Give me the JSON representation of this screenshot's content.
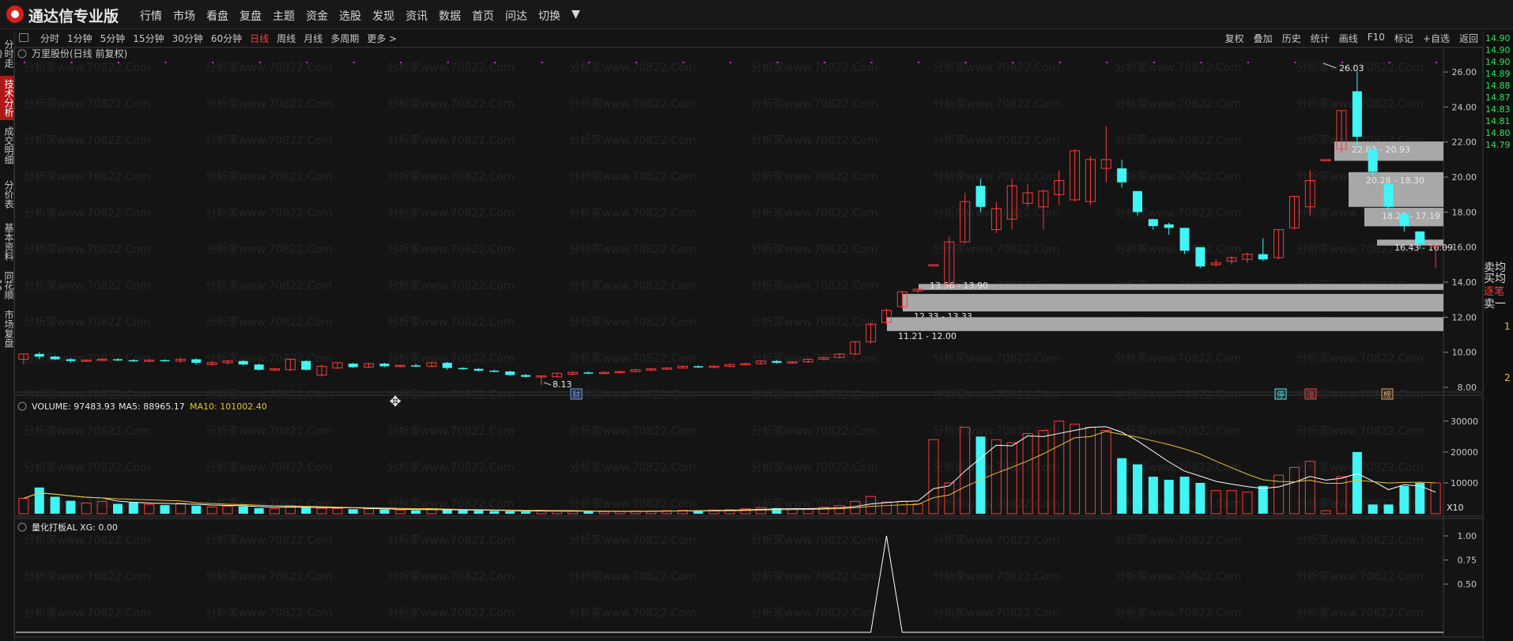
{
  "app": {
    "title": "通达信专业版"
  },
  "menu": [
    "行情",
    "市场",
    "看盘",
    "复盘",
    "主题",
    "资金",
    "选股",
    "发现",
    "资讯",
    "数据",
    "首页",
    "问达",
    "切换",
    "▼"
  ],
  "periods": [
    {
      "label": "分时",
      "active": false
    },
    {
      "label": "1分钟",
      "active": false
    },
    {
      "label": "5分钟",
      "active": false
    },
    {
      "label": "15分钟",
      "active": false
    },
    {
      "label": "30分钟",
      "active": false
    },
    {
      "label": "60分钟",
      "active": false
    },
    {
      "label": "日线",
      "active": true
    },
    {
      "label": "周线",
      "active": false
    },
    {
      "label": "月线",
      "active": false
    },
    {
      "label": "多周期",
      "active": false
    },
    {
      "label": "更多 >",
      "active": false
    }
  ],
  "right_tools": [
    "复权",
    "叠加",
    "历史",
    "统计",
    "画线",
    "F10",
    "标记",
    "+自选",
    "返回"
  ],
  "left_nav": [
    {
      "label": "分时走势",
      "active": false
    },
    {
      "label": "技术分析",
      "active": true
    },
    {
      "label": "成交明细",
      "active": false
    },
    {
      "label": "分价表",
      "active": false
    },
    {
      "label": "基本资料",
      "active": false
    },
    {
      "label": "同花顺10",
      "active": false
    },
    {
      "label": "市场复盘",
      "active": false
    }
  ],
  "main_title": "万里股份(日线 前复权)",
  "price_axis": [
    "26.00",
    "24.00",
    "22.00",
    "20.00",
    "18.00",
    "16.00",
    "14.00",
    "12.00",
    "10.00",
    "8.00"
  ],
  "right_prices": [
    "14.90",
    "14.90",
    "14.90",
    "14.89",
    "14.88",
    "14.87",
    "14.83",
    "14.81",
    "14.80",
    "14.79"
  ],
  "right_labels": [
    "卖均",
    "买均",
    "逐笔",
    "卖一",
    "1",
    "2"
  ],
  "annotations": {
    "high": "26.03",
    "low": "8.13",
    "cai": "财",
    "ting": "停",
    "zhang": "涨",
    "bang": "榜"
  },
  "price_zones": [
    {
      "label": "22.03 - 20.93",
      "color": "#a8a8a8"
    },
    {
      "label": "20.28 - 18.30",
      "color": "#a8a8a8"
    },
    {
      "label": "18.25 - 17.19",
      "color": "#a8a8a8"
    },
    {
      "label": "16.43 - 16.09",
      "color": "#a8a8a8"
    },
    {
      "label": "13.56 - 13.90",
      "color": "#a8a8a8"
    },
    {
      "label": "12.33 - 13.33",
      "color": "#a8a8a8"
    },
    {
      "label": "11.21 - 12.00",
      "color": "#a8a8a8"
    }
  ],
  "volume": {
    "header_name": "VOLUME: 97483.93",
    "ma5": "MA5: 88965.17",
    "ma10": "MA10: 101002.40",
    "axis": [
      "30000",
      "20000",
      "10000"
    ],
    "unit": "X10"
  },
  "indicator": {
    "header": "量化打板AL  XG: 0.00",
    "axis": [
      "1.00",
      "0.75",
      "0.50"
    ]
  },
  "watermark": "分析家www.70822.Com",
  "colors": {
    "up": "#ff3a3a",
    "down": "#3ff5f5",
    "ma5": "#ffffff",
    "ma10": "#e8c230",
    "accent": "#ff3b3b"
  },
  "chart_data": {
    "type": "candlestick",
    "ylim": [
      8,
      26.5
    ],
    "candles": [
      [
        9.6,
        9.9,
        9.3,
        9.9
      ],
      [
        9.9,
        9.75,
        9.6,
        10.0
      ],
      [
        9.75,
        9.6,
        9.55,
        9.8
      ],
      [
        9.6,
        9.5,
        9.4,
        9.65
      ],
      [
        9.5,
        9.55,
        9.45,
        9.6
      ],
      [
        9.55,
        9.6,
        9.5,
        9.65
      ],
      [
        9.6,
        9.55,
        9.5,
        9.65
      ],
      [
        9.55,
        9.5,
        9.45,
        9.6
      ],
      [
        9.5,
        9.55,
        9.45,
        9.6
      ],
      [
        9.55,
        9.5,
        9.45,
        9.6
      ],
      [
        9.5,
        9.6,
        9.4,
        9.7
      ],
      [
        9.6,
        9.4,
        9.3,
        9.65
      ],
      [
        9.3,
        9.4,
        9.25,
        9.5
      ],
      [
        9.4,
        9.5,
        9.3,
        9.55
      ],
      [
        9.5,
        9.3,
        9.25,
        9.55
      ],
      [
        9.3,
        9.0,
        8.95,
        9.35
      ],
      [
        9.0,
        9.05,
        8.95,
        9.1
      ],
      [
        9.0,
        9.6,
        8.95,
        9.65
      ],
      [
        9.5,
        9.0,
        8.95,
        9.55
      ],
      [
        8.7,
        9.2,
        8.6,
        9.3
      ],
      [
        9.1,
        9.4,
        9.05,
        9.45
      ],
      [
        9.35,
        9.15,
        9.1,
        9.4
      ],
      [
        9.15,
        9.35,
        9.1,
        9.4
      ],
      [
        9.35,
        9.2,
        9.15,
        9.4
      ],
      [
        9.2,
        9.25,
        9.15,
        9.3
      ],
      [
        9.25,
        9.2,
        9.15,
        9.35
      ],
      [
        9.2,
        9.4,
        9.15,
        9.45
      ],
      [
        9.4,
        9.1,
        9.0,
        9.45
      ],
      [
        9.1,
        9.05,
        9.0,
        9.15
      ],
      [
        9.05,
        8.95,
        8.9,
        9.1
      ],
      [
        8.95,
        8.9,
        8.85,
        9.0
      ],
      [
        8.9,
        8.7,
        8.65,
        8.95
      ],
      [
        8.7,
        8.6,
        8.55,
        8.75
      ],
      [
        8.6,
        8.65,
        8.13,
        8.7
      ],
      [
        8.6,
        8.8,
        8.55,
        8.85
      ],
      [
        8.75,
        8.85,
        8.7,
        8.9
      ],
      [
        8.85,
        8.8,
        8.75,
        8.9
      ],
      [
        8.8,
        8.85,
        8.75,
        8.9
      ],
      [
        8.85,
        8.9,
        8.8,
        8.95
      ],
      [
        8.9,
        9.0,
        8.85,
        9.05
      ],
      [
        9.0,
        9.05,
        8.95,
        9.1
      ],
      [
        9.05,
        9.1,
        9.0,
        9.15
      ],
      [
        9.1,
        9.2,
        9.05,
        9.25
      ],
      [
        9.2,
        9.15,
        9.1,
        9.25
      ],
      [
        9.15,
        9.2,
        9.1,
        9.25
      ],
      [
        9.2,
        9.3,
        9.15,
        9.35
      ],
      [
        9.3,
        9.35,
        9.25,
        9.4
      ],
      [
        9.35,
        9.5,
        9.3,
        9.55
      ],
      [
        9.5,
        9.4,
        9.35,
        9.55
      ],
      [
        9.4,
        9.45,
        9.35,
        9.5
      ],
      [
        9.45,
        9.6,
        9.4,
        9.65
      ],
      [
        9.6,
        9.7,
        9.55,
        9.75
      ],
      [
        9.7,
        9.9,
        9.65,
        9.95
      ],
      [
        9.9,
        10.6,
        9.85,
        10.65
      ],
      [
        10.6,
        11.6,
        10.5,
        11.7
      ],
      [
        11.7,
        12.4,
        11.6,
        12.5
      ],
      [
        12.6,
        13.45,
        12.5,
        13.5
      ],
      [
        13.5,
        13.6,
        13.4,
        13.65
      ],
      [
        15.0,
        15.0,
        15.0,
        15.0
      ],
      [
        13.9,
        16.3,
        13.9,
        16.6
      ],
      [
        16.3,
        18.6,
        16.2,
        19.1
      ],
      [
        19.5,
        18.3,
        18.0,
        19.9
      ],
      [
        17.0,
        18.2,
        16.8,
        18.6
      ],
      [
        17.6,
        19.5,
        17.0,
        19.9
      ],
      [
        18.5,
        19.1,
        18.3,
        19.6
      ],
      [
        18.3,
        19.2,
        17.0,
        19.3
      ],
      [
        19.0,
        19.8,
        18.4,
        20.4
      ],
      [
        18.7,
        21.5,
        18.6,
        21.6
      ],
      [
        18.6,
        21.0,
        18.4,
        21.2
      ],
      [
        20.5,
        21.0,
        19.7,
        22.9
      ],
      [
        20.5,
        19.7,
        19.4,
        21.0
      ],
      [
        19.2,
        18.0,
        17.8,
        19.2
      ],
      [
        17.6,
        17.2,
        17.0,
        17.6
      ],
      [
        17.3,
        17.1,
        16.7,
        17.4
      ],
      [
        17.1,
        15.8,
        15.6,
        17.1
      ],
      [
        16.0,
        14.9,
        14.8,
        16.0
      ],
      [
        15.0,
        15.1,
        14.9,
        15.3
      ],
      [
        15.2,
        15.4,
        15.0,
        15.5
      ],
      [
        15.3,
        15.6,
        15.1,
        15.7
      ],
      [
        15.6,
        15.3,
        15.2,
        16.5
      ],
      [
        15.4,
        17.0,
        15.3,
        17.0
      ],
      [
        17.1,
        18.9,
        17.0,
        18.9
      ],
      [
        18.3,
        19.8,
        17.8,
        20.4
      ],
      [
        21.0,
        21.0,
        21.0,
        21.0
      ],
      [
        21.6,
        23.8,
        21.4,
        23.8
      ],
      [
        24.9,
        22.3,
        21.7,
        26.03
      ],
      [
        21.6,
        20.3,
        20.1,
        21.6
      ],
      [
        19.6,
        18.3,
        18.1,
        19.6
      ],
      [
        17.9,
        17.2,
        16.9,
        17.9
      ],
      [
        16.9,
        16.2,
        15.9,
        16.9
      ],
      [
        16.1,
        16.1,
        14.8,
        16.1
      ]
    ],
    "volume": [
      5000,
      8500,
      5500,
      4200,
      3500,
      4000,
      3200,
      3600,
      3000,
      2800,
      3400,
      2600,
      2200,
      2500,
      2400,
      1800,
      1600,
      2600,
      2100,
      1800,
      1700,
      1500,
      1600,
      1400,
      1200,
      1100,
      1500,
      1300,
      1100,
      1000,
      900,
      800,
      700,
      1100,
      900,
      800,
      700,
      700,
      800,
      900,
      900,
      1000,
      1100,
      1000,
      1200,
      1300,
      1600,
      2000,
      1800,
      1400,
      1500,
      2100,
      2600,
      4000,
      5600,
      3800,
      4000,
      3200,
      24000,
      10000,
      28000,
      25000,
      24000,
      23000,
      26000,
      27000,
      30000,
      29000,
      28000,
      27000,
      18000,
      16000,
      12000,
      11000,
      12000,
      10000,
      7500,
      7500,
      7000,
      9000,
      12500,
      15000,
      17000,
      1000,
      12000,
      20000,
      3000,
      3000,
      9000,
      10000,
      10000
    ],
    "ma5": [
      0,
      0,
      0,
      0,
      0,
      0,
      0,
      0,
      0,
      0,
      0,
      0,
      0,
      0,
      0,
      0,
      0,
      0,
      0,
      0,
      0,
      0,
      0,
      0,
      0,
      0,
      0,
      0,
      0,
      0,
      0,
      0,
      0,
      0,
      0,
      0,
      0,
      0,
      0,
      0,
      0,
      0,
      0,
      0,
      0,
      0,
      0,
      0,
      0,
      0,
      0,
      0,
      0,
      0,
      0,
      0,
      0,
      0,
      0,
      0,
      0,
      0,
      0,
      0,
      0,
      0,
      0,
      0,
      0,
      0,
      0,
      0,
      0,
      0,
      0,
      0,
      0,
      0,
      0,
      0,
      0,
      0,
      0,
      0,
      0,
      0,
      0,
      0,
      0,
      0,
      0
    ],
    "xg_signal_index": 55
  }
}
